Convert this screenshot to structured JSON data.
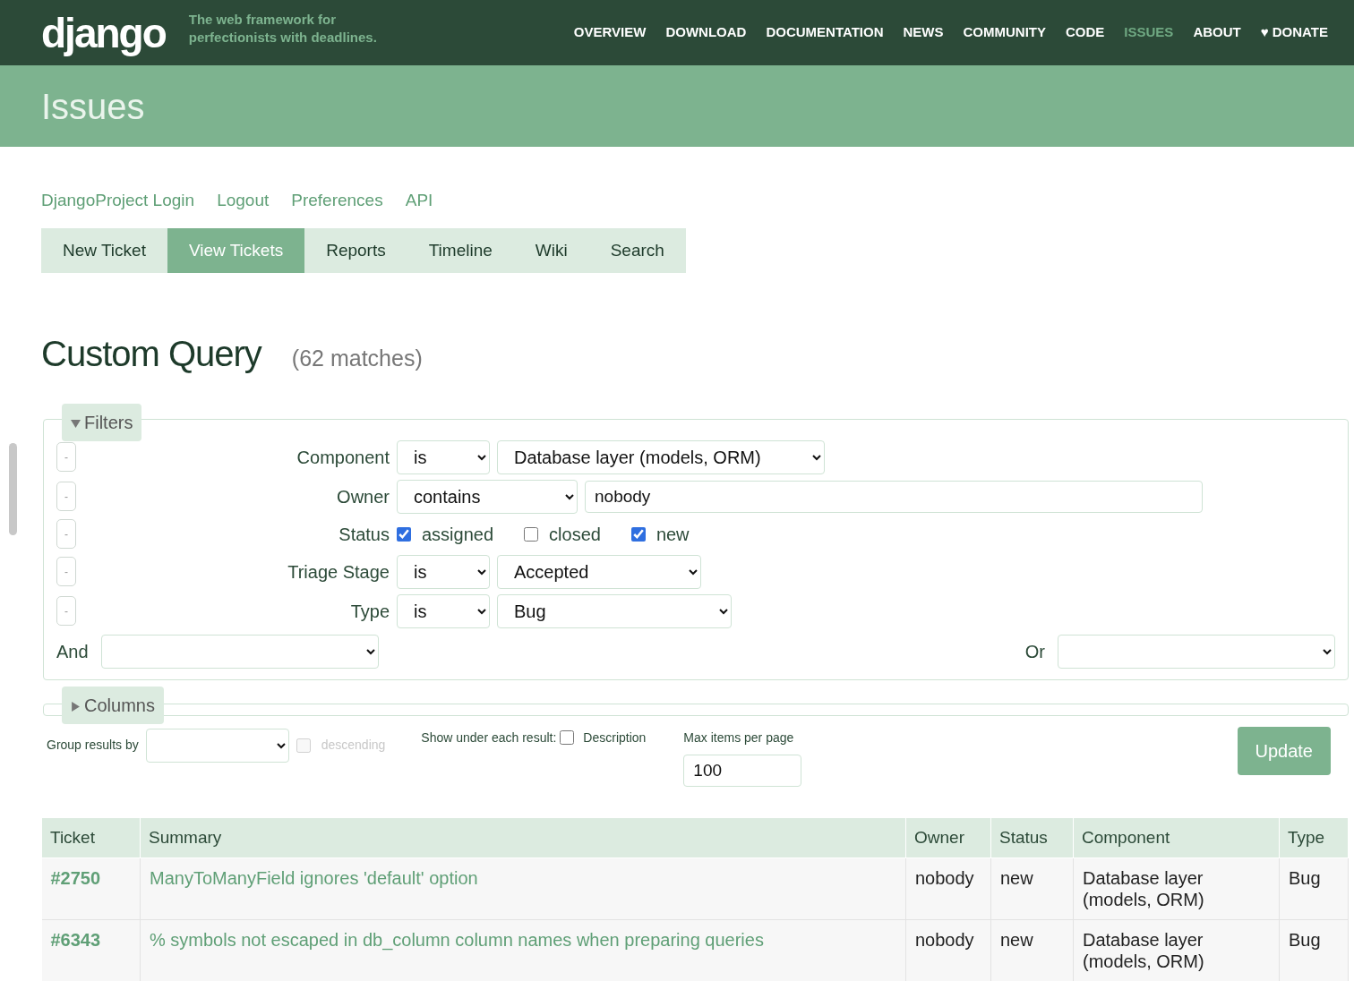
{
  "header": {
    "logo": "django",
    "tagline": "The web framework for perfectionists with deadlines.",
    "nav": [
      {
        "label": "OVERVIEW",
        "selected": false
      },
      {
        "label": "DOWNLOAD",
        "selected": false
      },
      {
        "label": "DOCUMENTATION",
        "selected": false
      },
      {
        "label": "NEWS",
        "selected": false
      },
      {
        "label": "COMMUNITY",
        "selected": false
      },
      {
        "label": "CODE",
        "selected": false
      },
      {
        "label": "ISSUES",
        "selected": true
      },
      {
        "label": "ABOUT",
        "selected": false
      },
      {
        "label": "♥ DONATE",
        "selected": false
      }
    ]
  },
  "banner": {
    "title": "Issues"
  },
  "meta_links": [
    "DjangoProject Login",
    "Logout",
    "Preferences",
    "API"
  ],
  "tabs": [
    {
      "label": "New Ticket",
      "selected": false
    },
    {
      "label": "View Tickets",
      "selected": true
    },
    {
      "label": "Reports",
      "selected": false
    },
    {
      "label": "Timeline",
      "selected": false
    },
    {
      "label": "Wiki",
      "selected": false
    },
    {
      "label": "Search",
      "selected": false
    }
  ],
  "query": {
    "title": "Custom Query",
    "matches": "(62 matches)"
  },
  "filters": {
    "legend": "Filters",
    "expanded": true,
    "remove_label": "-",
    "rows": [
      {
        "kind": "select",
        "label": "Component",
        "mode": "is",
        "value": "Database layer (models, ORM)"
      },
      {
        "kind": "text",
        "label": "Owner",
        "mode": "contains",
        "value": "nobody"
      },
      {
        "kind": "checks",
        "label": "Status",
        "options": [
          {
            "label": "assigned",
            "checked": true
          },
          {
            "label": "closed",
            "checked": false
          },
          {
            "label": "new",
            "checked": true
          }
        ]
      },
      {
        "kind": "select",
        "label": "Triage Stage",
        "mode": "is",
        "value": "Accepted"
      },
      {
        "kind": "select",
        "label": "Type",
        "mode": "is",
        "value": "Bug"
      }
    ],
    "and_label": "And",
    "or_label": "Or"
  },
  "columns": {
    "legend": "Columns",
    "expanded": false
  },
  "options": {
    "group_label": "Group results by",
    "descending": {
      "label": "descending",
      "checked": false,
      "disabled": true
    },
    "show_label": "Show under each result:",
    "description": {
      "label": "Description",
      "checked": false
    },
    "max_label": "Max items per page",
    "max_value": "100",
    "update": "Update"
  },
  "table": {
    "columns": [
      "Ticket",
      "Summary",
      "Owner",
      "Status",
      "Component",
      "Type"
    ],
    "rows": [
      {
        "ticket": "#2750",
        "summary": "ManyToManyField ignores 'default' option",
        "owner": "nobody",
        "status": "new",
        "component": "Database layer (models, ORM)",
        "type": "Bug"
      },
      {
        "ticket": "#6343",
        "summary": "% symbols not escaped in db_column column names when preparing queries",
        "owner": "nobody",
        "status": "new",
        "component": "Database layer (models, ORM)",
        "type": "Bug"
      }
    ]
  }
}
